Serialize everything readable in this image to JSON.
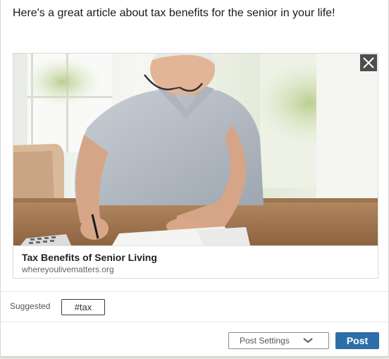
{
  "composer": {
    "post_text": "Here's a great article about tax benefits for the senior in your life!"
  },
  "link_preview": {
    "image_icon": "photo-senior-writing-at-table",
    "close_icon": "close-icon",
    "title": "Tax Benefits of Senior Living",
    "domain": "whereyoulivematters.org"
  },
  "hashtags": {
    "label": "Suggested",
    "items": [
      "#tax"
    ]
  },
  "footer": {
    "settings_label": "Post Settings",
    "settings_icon": "chevron-down-icon",
    "post_label": "Post"
  },
  "colors": {
    "post_button": "#2e6ea8",
    "chip_border": "#3a3a3a"
  }
}
